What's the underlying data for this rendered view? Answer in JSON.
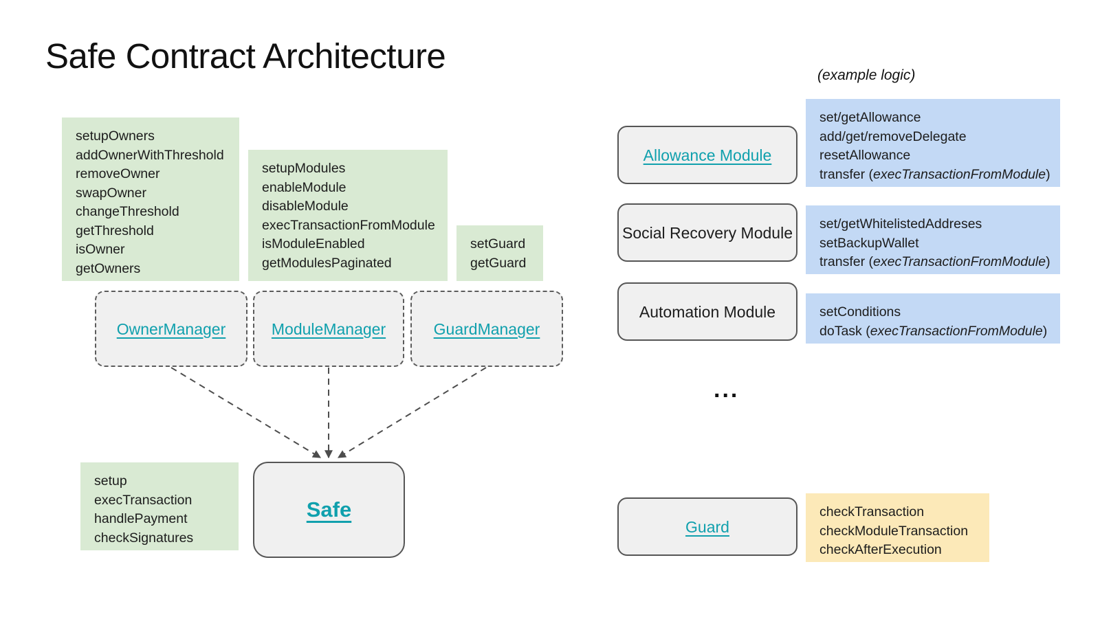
{
  "title": "Safe Contract Architecture",
  "captions": {
    "example_logic": "(example logic)",
    "ellipsis": "..."
  },
  "colors": {
    "green_panel": "#d9ead3",
    "blue_panel": "#c3d9f5",
    "amber_panel": "#fce9b8",
    "node_fill": "#f0f0f0",
    "node_border": "#555555",
    "link_teal": "#10a0ad",
    "connector": "#4d4d4d",
    "text": "#1c1c1c"
  },
  "left": {
    "owner_manager": {
      "node_label": "OwnerManager",
      "methods": [
        "setupOwners",
        "addOwnerWithThreshold",
        "removeOwner",
        "swapOwner",
        "changeThreshold",
        "getThreshold",
        "isOwner",
        "getOwners"
      ]
    },
    "module_manager": {
      "node_label": "ModuleManager",
      "methods": [
        "setupModules",
        "enableModule",
        "disableModule",
        "execTransactionFromModule",
        "isModuleEnabled",
        "getModulesPaginated"
      ]
    },
    "guard_manager": {
      "node_label": "GuardManager",
      "methods": [
        "setGuard",
        "getGuard"
      ]
    },
    "safe": {
      "node_label": "Safe",
      "methods": [
        "setup",
        "execTransaction",
        "handlePayment",
        "checkSignatures"
      ]
    }
  },
  "right": {
    "modules": [
      {
        "node_label": "Allowance Module",
        "is_link": true,
        "logic": [
          {
            "text": "set/getAllowance",
            "italic_part": ""
          },
          {
            "text": "add/get/removeDelegate",
            "italic_part": ""
          },
          {
            "text": "resetAllowance",
            "italic_part": ""
          },
          {
            "text": "transfer (",
            "italic_part": "execTransactionFromModule",
            "tail": ")"
          }
        ]
      },
      {
        "node_label": "Social Recovery Module",
        "is_link": false,
        "logic": [
          {
            "text": "set/getWhitelistedAddreses",
            "italic_part": ""
          },
          {
            "text": "setBackupWallet",
            "italic_part": ""
          },
          {
            "text": "transfer (",
            "italic_part": "execTransactionFromModule",
            "tail": ")"
          }
        ]
      },
      {
        "node_label": "Automation Module",
        "is_link": false,
        "logic": [
          {
            "text": "setConditions",
            "italic_part": ""
          },
          {
            "text": "doTask (",
            "italic_part": "execTransactionFromModule",
            "tail": ")"
          }
        ]
      }
    ],
    "guard": {
      "node_label": "Guard",
      "is_link": true,
      "logic": [
        {
          "text": "checkTransaction",
          "italic_part": ""
        },
        {
          "text": "checkModuleTransaction",
          "italic_part": ""
        },
        {
          "text": "checkAfterExecution",
          "italic_part": ""
        }
      ]
    }
  }
}
